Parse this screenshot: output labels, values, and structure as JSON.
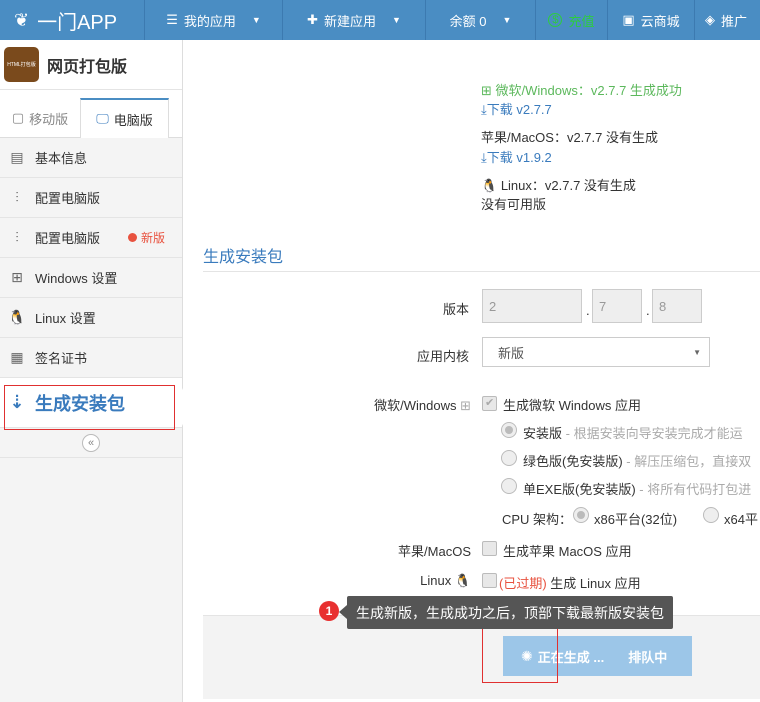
{
  "topbar": {
    "brand": "一门APP",
    "items": [
      {
        "label": "我的应用",
        "icon": "list-icon"
      },
      {
        "label": "新建应用",
        "icon": "plus-icon"
      },
      {
        "label": "余额 0"
      },
      {
        "label": "充值",
        "icon": "coin-icon"
      },
      {
        "label": "云商城",
        "icon": "shop-icon"
      },
      {
        "label": "推广",
        "icon": "diamond-icon"
      }
    ]
  },
  "sidebar": {
    "app_logo_text": "HTML打包版",
    "app_name": "网页打包版",
    "tabs": [
      "移动版",
      "电脑版"
    ],
    "menu": [
      {
        "label": "基本信息",
        "icon": "document-icon"
      },
      {
        "label": "配置电脑版",
        "icon": "sliders-icon"
      },
      {
        "label": "配置电脑版",
        "icon": "sliders-icon",
        "badge": "新版"
      },
      {
        "label": "Windows 设置",
        "icon": "windows-icon"
      },
      {
        "label": "Linux 设置",
        "icon": "linux-icon"
      },
      {
        "label": "签名证书",
        "icon": "certificate-icon"
      },
      {
        "label": "生成安装包",
        "icon": "sort-download-icon"
      }
    ],
    "collapse_glyph": "«"
  },
  "downloads": {
    "windows_status": "微软/Windows：v2.7.7 生成成功",
    "windows_link": "下载 v2.7.7",
    "mac_status": "苹果/MacOS：v2.7.7 没有生成",
    "mac_link": "下载 v1.9.2",
    "linux_status": "Linux：v2.7.7 没有生成",
    "linux_note": "没有可用版"
  },
  "form": {
    "section_title": "生成安装包",
    "version_label": "版本",
    "version": [
      "2",
      "7",
      "8"
    ],
    "kernel_label": "应用内核",
    "kernel_value": "新版",
    "windows_label": "微软/Windows",
    "windows_option": "生成微软 Windows 应用",
    "install_types": [
      {
        "label": "安装版",
        "desc": " - 根据安装向导安装完成才能运"
      },
      {
        "label": "绿色版(免安装版)",
        "desc": " - 解压压缩包，直接双"
      },
      {
        "label": "单EXE版(免安装版)",
        "desc": " - 将所有代码打包进"
      }
    ],
    "cpu_label": "CPU 架构：",
    "cpu_options": [
      "x86平台(32位)",
      "x64平"
    ],
    "mac_label": "苹果/MacOS",
    "mac_option": "生成苹果 MacOS 应用",
    "linux_label": "Linux",
    "linux_expired": "(已过期)",
    "linux_option": "生成 Linux 应用"
  },
  "actions": {
    "generating": "正在生成 ...",
    "queued": "排队中"
  },
  "tooltip": {
    "step": "1",
    "text": "生成新版，生成成功之后，顶部下载最新版安装包"
  }
}
